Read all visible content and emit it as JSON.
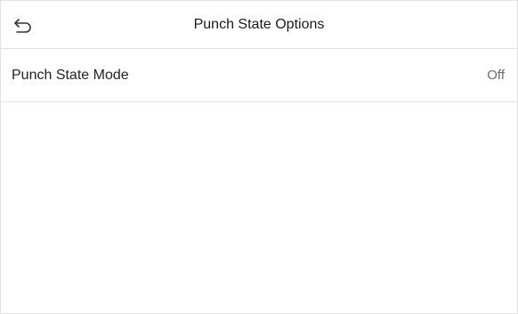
{
  "header": {
    "title": "Punch State Options",
    "back_icon": "back-arrow-icon"
  },
  "settings": [
    {
      "label": "Punch State Mode",
      "value": "Off"
    }
  ],
  "colors": {
    "text": "#1a1a1a",
    "value_text": "#6a6a6a",
    "divider": "#e2e2e2",
    "background": "#ffffff"
  }
}
